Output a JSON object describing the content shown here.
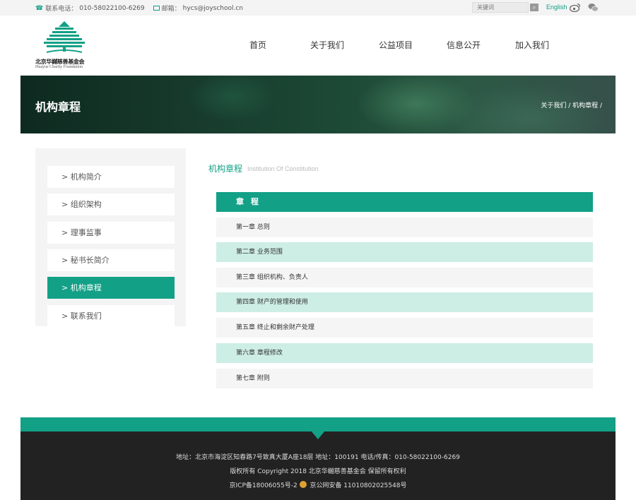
{
  "topbar": {
    "phone_label": "联系电话：",
    "phone": "010-58022100-6269",
    "email_label": "邮箱：",
    "email": "hycs@joyschool.cn",
    "search_placeholder": "关键词",
    "english": "English",
    "icons": {
      "phone": "phone-icon",
      "email": "mail-icon",
      "search": "search-icon",
      "weibo": "weibo-icon",
      "wechat": "wechat-icon"
    }
  },
  "logo": {
    "name_cn": "北京华樾慈善基金会",
    "name_en": "Huayue Charity Foundation"
  },
  "nav": [
    "首页",
    "关于我们",
    "公益项目",
    "信息公开",
    "加入我们"
  ],
  "banner": {
    "title": "机构章程",
    "breadcrumb": "关于我们 / 机构章程 /"
  },
  "sidebar": {
    "items": [
      {
        "label": "> 机构简介",
        "active": false
      },
      {
        "label": "> 组织架构",
        "active": false
      },
      {
        "label": "> 理事监事",
        "active": false
      },
      {
        "label": "> 秘书长简介",
        "active": false
      },
      {
        "label": "> 机构章程",
        "active": true
      },
      {
        "label": "> 联系我们",
        "active": false
      }
    ]
  },
  "content": {
    "title": "机构章程",
    "subtitle": "Institution Of Constitution",
    "table_header": "章 程",
    "chapters": [
      "第一章 总则",
      "第二章 业务范围",
      "第三章 组织机构、负责人",
      "第四章 财产的管理和使用",
      "第五章 终止和剩余财产处理",
      "第六章 章程修改",
      "第七章 附则"
    ]
  },
  "footer": {
    "address": "地址：北京市海淀区知春路7号致真大厦A座18层  地址：100191  电话/传真：010-58022100-6269",
    "copyright": "版权所有  Copyright 2018  北京华樾慈善基金会  保留所有权利",
    "icp": "京ICP备18006055号-2",
    "police": "京公网安备 11010802025548号"
  },
  "colors": {
    "brand_green": "#12a086",
    "light_green_row": "#cdeee5",
    "footer_dark": "#222222"
  }
}
